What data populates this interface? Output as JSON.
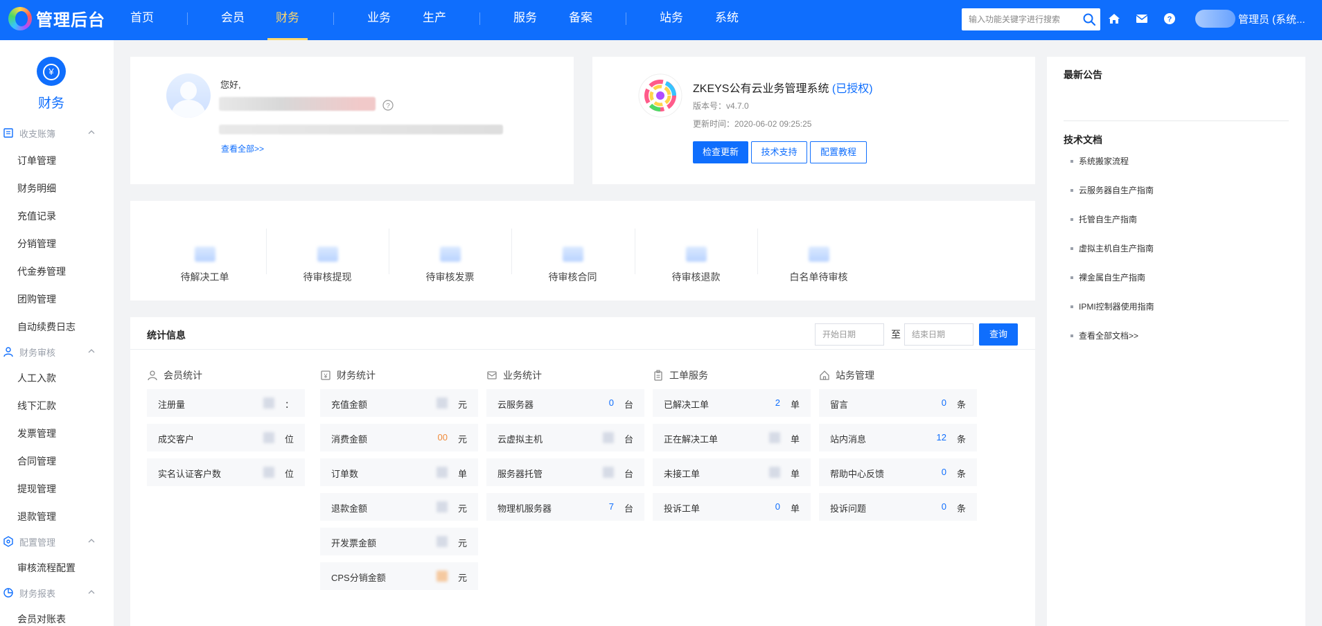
{
  "topbar": {
    "title": "管理后台",
    "nav": [
      "首页",
      "会员",
      "财务",
      "业务",
      "生产",
      "服务",
      "备案",
      "站务",
      "系统"
    ],
    "active_nav": "财务",
    "search_placeholder": "输入功能关键字进行搜索",
    "icons": [
      "search-icon",
      "home-icon",
      "mail-icon",
      "help-icon"
    ],
    "user_label": "管理员 (系统...",
    "accent": "#0f6efd",
    "active_color": "#ffd86b"
  },
  "sidebar": {
    "header_icon": "yuan-icon",
    "title": "财务",
    "groups": [
      {
        "label": "收支账簿",
        "icon": "ledger-icon",
        "items": [
          "订单管理",
          "财务明细",
          "充值记录",
          "分销管理",
          "代金券管理",
          "团购管理",
          "自动续费日志"
        ]
      },
      {
        "label": "财务审核",
        "icon": "user-icon",
        "items": [
          "人工入款",
          "线下汇款",
          "发票管理",
          "合同管理",
          "提现管理",
          "退款管理"
        ]
      },
      {
        "label": "配置管理",
        "icon": "gear-icon",
        "items": [
          "审核流程配置"
        ]
      },
      {
        "label": "财务报表",
        "icon": "pie-icon",
        "items": [
          "会员对账表"
        ]
      }
    ]
  },
  "welcome": {
    "greeting": "您好,",
    "view_all": "查看全部>>"
  },
  "system": {
    "name": "ZKEYS公有云业务管理系统",
    "auth_status": "(已授权)",
    "version": "版本号：v4.7.0",
    "updated": "更新时间：2020-06-02 09:25:25",
    "buttons": [
      "检查更新",
      "技术支持",
      "配置教程"
    ]
  },
  "pending": [
    "待解决工单",
    "待审核提现",
    "待审核发票",
    "待审核合同",
    "待审核退款",
    "白名单待审核"
  ],
  "stats": {
    "title": "统计信息",
    "start_placeholder": "开始日期",
    "to_label": "至",
    "end_placeholder": "结束日期",
    "query_label": "查询",
    "columns": [
      {
        "title": "会员统计",
        "icon": "user-icon",
        "rows": [
          {
            "label": "注册量",
            "value": "",
            "unit": "："
          },
          {
            "label": "成交客户",
            "value": "",
            "unit": "位"
          },
          {
            "label": "实名认证客户数",
            "value": "",
            "unit": "位"
          }
        ]
      },
      {
        "title": "财务统计",
        "icon": "finance-icon",
        "rows": [
          {
            "label": "充值金额",
            "value": "",
            "unit": "元"
          },
          {
            "label": "消费金额",
            "value": "00",
            "unit": "元"
          },
          {
            "label": "订单数",
            "value": "",
            "unit": "单"
          },
          {
            "label": "退款金额",
            "value": "",
            "unit": "元"
          },
          {
            "label": "开发票金额",
            "value": "",
            "unit": "元"
          },
          {
            "label": "CPS分销金额",
            "value": "",
            "unit": "元"
          }
        ]
      },
      {
        "title": "业务统计",
        "icon": "business-icon",
        "rows": [
          {
            "label": "云服务器",
            "value": "0",
            "unit": "台"
          },
          {
            "label": "云虚拟主机",
            "value": "",
            "unit": "台"
          },
          {
            "label": "服务器托管",
            "value": "",
            "unit": "台"
          },
          {
            "label": "物理机服务器",
            "value": "7",
            "unit": "台"
          }
        ]
      },
      {
        "title": "工单服务",
        "icon": "clipboard-icon",
        "rows": [
          {
            "label": "已解决工单",
            "value": "2",
            "unit": "单"
          },
          {
            "label": "正在解决工单",
            "value": "",
            "unit": "单"
          },
          {
            "label": "未接工单",
            "value": "",
            "unit": "单"
          },
          {
            "label": "投诉工单",
            "value": "0",
            "unit": "单"
          }
        ]
      },
      {
        "title": "站务管理",
        "icon": "site-icon",
        "rows": [
          {
            "label": "留言",
            "value": "0",
            "unit": "条"
          },
          {
            "label": "站内消息",
            "value": "12",
            "unit": "条"
          },
          {
            "label": "帮助中心反馈",
            "value": "0",
            "unit": "条"
          },
          {
            "label": "投诉问题",
            "value": "0",
            "unit": "条"
          }
        ]
      }
    ]
  },
  "right": {
    "notice_title": "最新公告",
    "docs_title": "技术文档",
    "docs": [
      "系统搬家流程",
      "云服务器自生产指南",
      "托管自生产指南",
      "虚拟主机自生产指南",
      "裸金属自生产指南",
      "IPMI控制器使用指南",
      "查看全部文档>>"
    ]
  }
}
